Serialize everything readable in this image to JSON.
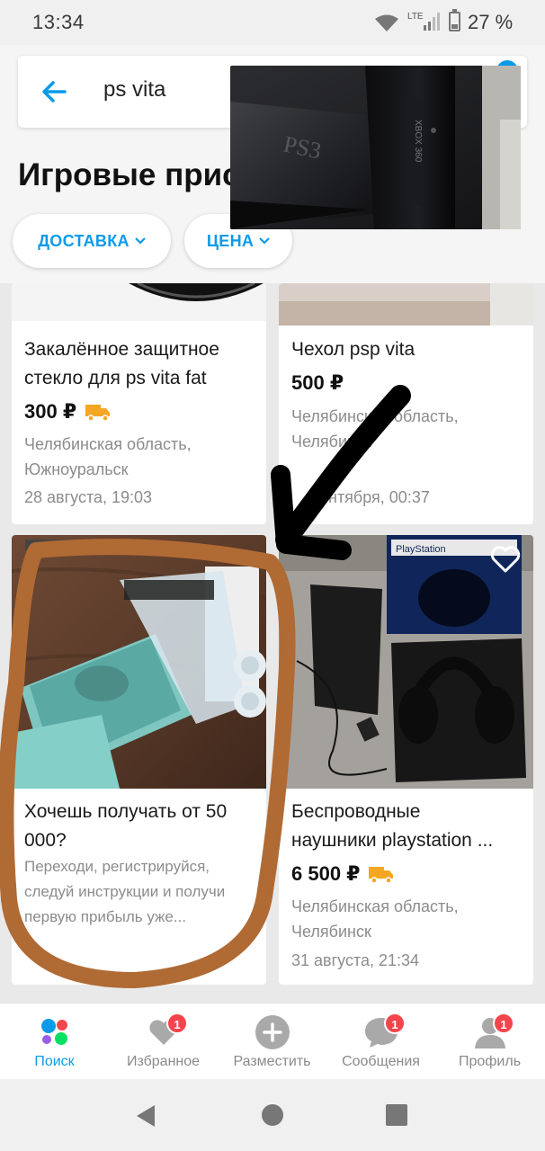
{
  "status_bar": {
    "time": "13:34",
    "network": "LTE",
    "battery": "27 %",
    "battery_level": 0.27
  },
  "search": {
    "value": "ps vita"
  },
  "page_title": "Игровые прис",
  "filters": [
    {
      "label": "ДОСТАВКА"
    },
    {
      "label": "ЦЕНА"
    }
  ],
  "listings": [
    {
      "title_lines": [
        "Закалённое защитное",
        "стекло для ps vita fat"
      ],
      "price": "300 ₽",
      "delivery": true,
      "location_lines": [
        "Челябинская область,",
        "Южноуральск"
      ],
      "date": "28 августа, 19:03"
    },
    {
      "title_lines": [
        "Чехол psp vita"
      ],
      "price": "500 ₽",
      "delivery": false,
      "location_lines": [
        "Челябинская область,",
        "Челябинск"
      ],
      "date": "нтября, 00:37"
    },
    {
      "title_lines": [
        "Хочешь получать от 50",
        "000?"
      ],
      "description_lines": [
        "Переходи, регистрируйся,",
        "следуй инструкции и получи",
        "первую прибыль уже..."
      ]
    },
    {
      "title_lines": [
        "Беспроводные",
        "наушники playstation ..."
      ],
      "price": "6 500 ₽",
      "delivery": true,
      "location_lines": [
        "Челябинская область,",
        "Челябинск"
      ],
      "date": "31 августа, 21:34",
      "favorite_icon": "heart-outline-icon"
    }
  ],
  "bottom_nav": [
    {
      "label": "Поиск",
      "icon": "search-dots-icon",
      "active": true,
      "badge": ""
    },
    {
      "label": "Избранное",
      "icon": "heart-icon",
      "active": false,
      "badge": "1"
    },
    {
      "label": "Разместить",
      "icon": "plus-circle-icon",
      "active": false,
      "badge": ""
    },
    {
      "label": "Сообщения",
      "icon": "chat-bubble-icon",
      "active": false,
      "badge": "1"
    },
    {
      "label": "Профиль",
      "icon": "person-icon",
      "active": false,
      "badge": "1"
    }
  ],
  "colors": {
    "accent": "#0a9be8",
    "badge": "#f5454c",
    "delivery": "#f5a623",
    "annotation_brown": "#b06a34",
    "annotation_black": "#000000"
  }
}
